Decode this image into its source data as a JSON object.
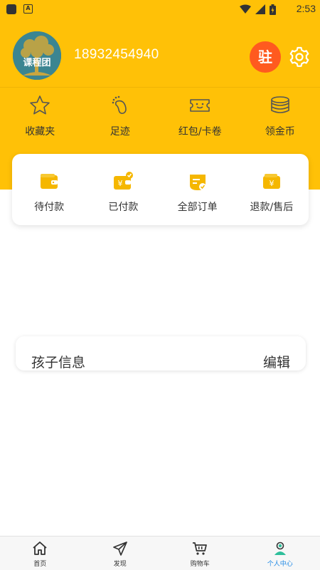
{
  "status_bar": {
    "time": "2:53",
    "app_icon": "A"
  },
  "profile": {
    "phone": "18932454940",
    "avatar_text": "课程团",
    "settle_button": "驻"
  },
  "quick_actions": [
    {
      "label": "收藏夹",
      "icon": "star-icon"
    },
    {
      "label": "足迹",
      "icon": "footprint-icon"
    },
    {
      "label": "红包/卡卷",
      "icon": "coupon-icon"
    },
    {
      "label": "领金币",
      "icon": "coins-icon"
    }
  ],
  "orders": [
    {
      "label": "待付款",
      "icon": "wallet-icon"
    },
    {
      "label": "已付款",
      "icon": "paid-icon"
    },
    {
      "label": "全部订单",
      "icon": "all-orders-icon"
    },
    {
      "label": "退款/售后",
      "icon": "refund-icon"
    }
  ],
  "child_info": {
    "title": "孩子信息",
    "edit": "编辑"
  },
  "tabbar": [
    {
      "label": "首页",
      "icon": "home-icon",
      "active": false
    },
    {
      "label": "发现",
      "icon": "send-icon",
      "active": false
    },
    {
      "label": "购物车",
      "icon": "cart-icon",
      "active": false
    },
    {
      "label": "个人中心",
      "icon": "user-icon",
      "active": true
    }
  ],
  "colors": {
    "header": "#ffc107",
    "accent_icon": "#f5b700",
    "settle": "#ff5a1f",
    "active_tab": "#1e88e5"
  }
}
